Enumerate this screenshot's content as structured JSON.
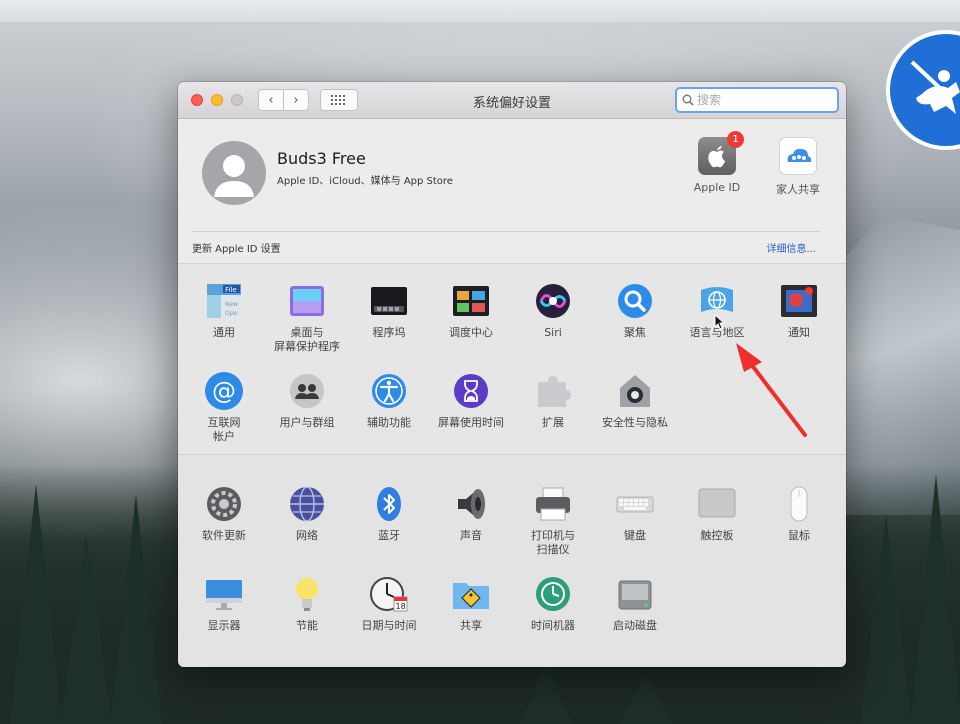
{
  "window": {
    "title": "系统偏好设置",
    "search_placeholder": "搜索"
  },
  "account": {
    "name": "Buds3 Free",
    "subtitle": "Apple ID、iCloud、媒体与 App Store",
    "apple_id_label": "Apple ID",
    "apple_id_badge": "1",
    "family_label": "家人共享",
    "update_notice": "更新 Apple ID 设置",
    "more_link": "详细信息..."
  },
  "prefs_row1": [
    {
      "label": "通用",
      "icon": "general-icon"
    },
    {
      "label": "桌面与\n屏幕保护程序",
      "icon": "desktop-screensaver-icon"
    },
    {
      "label": "程序坞",
      "icon": "dock-icon"
    },
    {
      "label": "调度中心",
      "icon": "mission-control-icon"
    },
    {
      "label": "Siri",
      "icon": "siri-icon"
    },
    {
      "label": "聚焦",
      "icon": "spotlight-icon"
    },
    {
      "label": "语言与地区",
      "icon": "language-region-icon"
    },
    {
      "label": "通知",
      "icon": "notifications-icon"
    }
  ],
  "prefs_row2": [
    {
      "label": "互联网\n帐户",
      "icon": "internet-accounts-icon"
    },
    {
      "label": "用户与群组",
      "icon": "users-groups-icon"
    },
    {
      "label": "辅助功能",
      "icon": "accessibility-icon"
    },
    {
      "label": "屏幕使用时间",
      "icon": "screen-time-icon"
    },
    {
      "label": "扩展",
      "icon": "extensions-icon"
    },
    {
      "label": "安全性与隐私",
      "icon": "security-privacy-icon"
    }
  ],
  "prefs_row3": [
    {
      "label": "软件更新",
      "icon": "software-update-icon"
    },
    {
      "label": "网络",
      "icon": "network-icon"
    },
    {
      "label": "蓝牙",
      "icon": "bluetooth-icon"
    },
    {
      "label": "声音",
      "icon": "sound-icon"
    },
    {
      "label": "打印机与\n扫描仪",
      "icon": "printers-scanners-icon"
    },
    {
      "label": "键盘",
      "icon": "keyboard-icon"
    },
    {
      "label": "触控板",
      "icon": "trackpad-icon"
    },
    {
      "label": "鼠标",
      "icon": "mouse-icon"
    }
  ],
  "prefs_row4": [
    {
      "label": "显示器",
      "icon": "displays-icon"
    },
    {
      "label": "节能",
      "icon": "energy-saver-icon"
    },
    {
      "label": "日期与时间",
      "icon": "date-time-icon",
      "calendar_text": "18"
    },
    {
      "label": "共享",
      "icon": "sharing-icon"
    },
    {
      "label": "时间机器",
      "icon": "time-machine-icon"
    },
    {
      "label": "启动磁盘",
      "icon": "startup-disk-icon"
    }
  ],
  "colors": {
    "accent": "#2160c8",
    "annotation_arrow": "#ef2f2a",
    "badge": "#ee3a36"
  }
}
